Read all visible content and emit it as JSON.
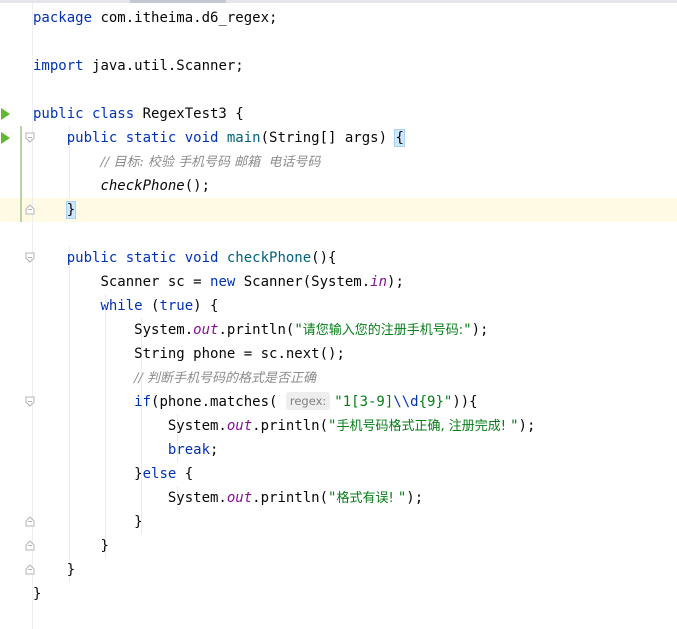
{
  "editor": {
    "lines": [
      [
        {
          "t": "package ",
          "c": "kw"
        },
        {
          "t": "com.itheima.d6_regex;"
        }
      ],
      [],
      [
        {
          "t": "import ",
          "c": "kw"
        },
        {
          "t": "java.util.Scanner;"
        }
      ],
      [],
      [
        {
          "t": "public class ",
          "c": "kw"
        },
        {
          "t": "RegexTest3 {"
        }
      ],
      [
        {
          "t": "    "
        },
        {
          "t": "public static void ",
          "c": "kw"
        },
        {
          "t": "main",
          "c": "fn"
        },
        {
          "t": "(String[] args) "
        },
        {
          "t": "{",
          "c": "brace-match"
        }
      ],
      [
        {
          "t": "        "
        },
        {
          "t": "// 目标: 校验 手机号码 邮箱  电话号码",
          "c": "comment"
        }
      ],
      [
        {
          "t": "        "
        },
        {
          "t": "checkPhone",
          "c": "italic"
        },
        {
          "t": "();"
        }
      ],
      [
        {
          "t": "    "
        },
        {
          "t": "}",
          "c": "brace-match"
        }
      ],
      [],
      [
        {
          "t": "    "
        },
        {
          "t": "public static void ",
          "c": "kw"
        },
        {
          "t": "checkPhone",
          "c": "fn"
        },
        {
          "t": "(){"
        }
      ],
      [
        {
          "t": "        "
        },
        {
          "t": "Scanner sc = "
        },
        {
          "t": "new ",
          "c": "kw"
        },
        {
          "t": "Scanner(System."
        },
        {
          "t": "in",
          "c": "field"
        },
        {
          "t": ");"
        }
      ],
      [
        {
          "t": "        "
        },
        {
          "t": "while ",
          "c": "kw"
        },
        {
          "t": "("
        },
        {
          "t": "true",
          "c": "kw"
        },
        {
          "t": ") {"
        }
      ],
      [
        {
          "t": "            "
        },
        {
          "t": "System."
        },
        {
          "t": "out",
          "c": "field"
        },
        {
          "t": ".println("
        },
        {
          "t": "\"",
          "c": "str"
        },
        {
          "t": "请您输入您的注册手机号码:",
          "c": "str-cn"
        },
        {
          "t": "\"",
          "c": "str"
        },
        {
          "t": ");"
        }
      ],
      [
        {
          "t": "            "
        },
        {
          "t": "String phone = sc.next();"
        }
      ],
      [
        {
          "t": "            "
        },
        {
          "t": "// 判断手机号码的格式是否正确",
          "c": "comment"
        }
      ],
      [
        {
          "t": "            "
        },
        {
          "t": "if",
          "c": "kw"
        },
        {
          "t": "(phone.matches( "
        },
        {
          "t": "regex:",
          "c": "hint"
        },
        {
          "t": "\"1[3-9]",
          "c": "str"
        },
        {
          "t": "\\\\d",
          "c": "escape"
        },
        {
          "t": "{9}\"",
          "c": "str"
        },
        {
          "t": ")){"
        }
      ],
      [
        {
          "t": "                "
        },
        {
          "t": "System."
        },
        {
          "t": "out",
          "c": "field"
        },
        {
          "t": ".println("
        },
        {
          "t": "\"",
          "c": "str"
        },
        {
          "t": "手机号码格式正确, 注册完成! ",
          "c": "str-cn"
        },
        {
          "t": "\"",
          "c": "str"
        },
        {
          "t": ");"
        }
      ],
      [
        {
          "t": "                "
        },
        {
          "t": "break",
          "c": "kw"
        },
        {
          "t": ";"
        }
      ],
      [
        {
          "t": "            "
        },
        {
          "t": "}"
        },
        {
          "t": "else ",
          "c": "kw"
        },
        {
          "t": "{"
        }
      ],
      [
        {
          "t": "                "
        },
        {
          "t": "System."
        },
        {
          "t": "out",
          "c": "field"
        },
        {
          "t": ".println("
        },
        {
          "t": "\"",
          "c": "str"
        },
        {
          "t": "格式有误! ",
          "c": "str-cn"
        },
        {
          "t": "\"",
          "c": "str"
        },
        {
          "t": ");"
        }
      ],
      [
        {
          "t": "            "
        },
        {
          "t": "}"
        }
      ],
      [
        {
          "t": "        "
        },
        {
          "t": "}"
        }
      ],
      [
        {
          "t": "    "
        },
        {
          "t": "}"
        }
      ],
      [
        {
          "t": "}"
        }
      ]
    ],
    "current_line": 9,
    "run_icon_lines": [
      5,
      6
    ],
    "fold_lines": [
      {
        "line": 6,
        "kind": "open"
      },
      {
        "line": 9,
        "kind": "close"
      },
      {
        "line": 11,
        "kind": "open"
      },
      {
        "line": 17,
        "kind": "open"
      },
      {
        "line": 22,
        "kind": "close"
      },
      {
        "line": 23,
        "kind": "close"
      },
      {
        "line": 24,
        "kind": "close"
      }
    ],
    "colors": {
      "keyword": "#0033b3",
      "method": "#00627a",
      "string": "#067d17",
      "field": "#871094",
      "comment": "#8c8c8c",
      "current_line_bg": "#fffae3",
      "run_icon": "#5fb832"
    }
  }
}
